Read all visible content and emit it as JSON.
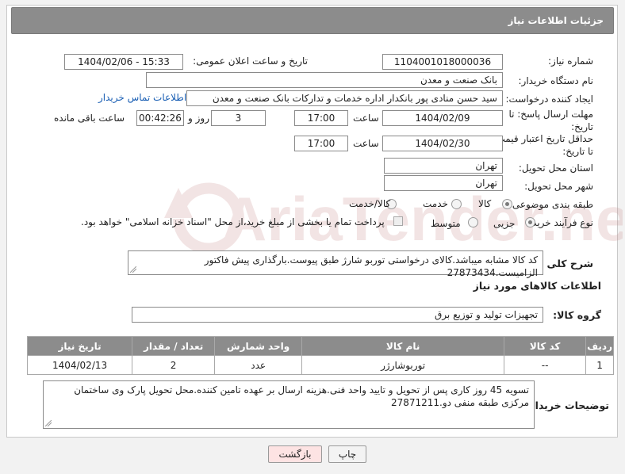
{
  "header": {
    "title": "جزئیات اطلاعات نیاز"
  },
  "form": {
    "need_number_label": "شماره نیاز:",
    "need_number": "1104001018000036",
    "announce_label": "تاریخ و ساعت اعلان عمومی:",
    "announce_value": "1404/02/06 - 15:33",
    "buyer_org_label": "نام دستگاه خریدار:",
    "buyer_org": "بانک صنعت و معدن",
    "creator_label": "ایجاد کننده درخواست:",
    "creator": "سید حسن منادی پور بانکدار اداره خدمات و تداركات بانک صنعت و معدن",
    "contact_link": "اطلاعات تماس خریدار",
    "deadline_label_1": "مهلت ارسال پاسخ: تا",
    "deadline_label_2": "تاریخ:",
    "deadline_date": "1404/02/09",
    "time_label": "ساعت",
    "deadline_time": "17:00",
    "days": "3",
    "days_label": "روز و",
    "remaining": "00:42:26",
    "remaining_label": "ساعت باقی مانده",
    "validity_label_1": "حداقل تاریخ اعتبار قیمت:",
    "validity_label_2": "تا تاریخ:",
    "validity_date": "1404/02/30",
    "validity_time": "17:00",
    "province_label": "استان محل تحویل:",
    "province": "تهران",
    "city_label": "شهر محل تحویل:",
    "city": "تهران",
    "category_label": "طبقه بندی موضوعی:",
    "category_options": [
      "کالا",
      "خدمت",
      "کالا/خدمت"
    ],
    "category_selected": "کالا",
    "process_label": "نوع فرآیند خرید :",
    "process_options": [
      "جزیی",
      "متوسط"
    ],
    "process_selected": "جزیی",
    "payment_note": "پرداخت تمام یا بخشی از مبلغ خرید،از محل \"اسناد خزانه اسلامی\" خواهد بود.",
    "summary_label": "شرح کلی نیاز:",
    "summary": "کد کالا مشابه میباشد.کالای درخواستی توربو شارژ طبق پیوست.بارگذاری پیش فاکتور الزامیست.27873434"
  },
  "goods": {
    "section_title": "اطلاعات کالاهای مورد نیاز",
    "group_label": "گروه کالا:",
    "group_value": "تجهیزات تولید و توزیع برق",
    "columns": [
      "ردیف",
      "کد کالا",
      "نام کالا",
      "واحد شمارش",
      "تعداد / مقدار",
      "تاریخ نیاز"
    ],
    "rows": [
      [
        "1",
        "--",
        "توربوشارژر",
        "عدد",
        "2",
        "1404/02/13"
      ]
    ]
  },
  "buyer_notes": {
    "label": "توضیحات خریدار:",
    "text": "تسویه 45 روز کاری پس از تحویل و تایید واحد فنی.هزینه ارسال بر عهده تامین کننده.محل تحویل پارک وی ساختمان مرکزی طبقه منفی دو.27871211"
  },
  "buttons": {
    "print": "چاپ",
    "back": "بازگشت"
  },
  "watermark_text": "AriaTender.neT",
  "colors": {
    "header_bg": "#8c8c8c",
    "link": "#1a5fb4",
    "back_bg": "#fde3e3",
    "watermark": "#e0b8b8"
  }
}
